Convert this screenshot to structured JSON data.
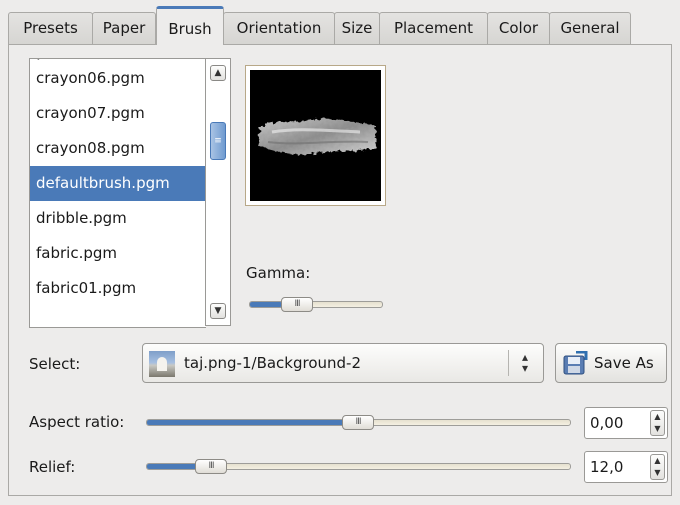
{
  "tabs": [
    {
      "label": "Presets",
      "active": false
    },
    {
      "label": "Paper",
      "active": false
    },
    {
      "label": "Brush",
      "active": true
    },
    {
      "label": "Orientation",
      "active": false
    },
    {
      "label": "Size",
      "active": false
    },
    {
      "label": "Placement",
      "active": false
    },
    {
      "label": "Color",
      "active": false
    },
    {
      "label": "General",
      "active": false
    }
  ],
  "brush_list": {
    "items": [
      "crayon06.pgm",
      "crayon07.pgm",
      "crayon08.pgm",
      "defaultbrush.pgm",
      "dribble.pgm",
      "fabric.pgm",
      "fabric01.pgm"
    ],
    "selected": "defaultbrush.pgm"
  },
  "gamma": {
    "label": "Gamma:",
    "value_fraction": 0.25
  },
  "select": {
    "label": "Select:",
    "value": "taj.png-1/Background-2"
  },
  "save_as": {
    "label": "Save As"
  },
  "aspect_ratio": {
    "label": "Aspect ratio:",
    "value": "0,00",
    "value_fraction": 0.5
  },
  "relief": {
    "label": "Relief:",
    "value": "12,0",
    "value_fraction": 0.17
  },
  "colors": {
    "accent": "#4a7ab8",
    "preview_bg": "#000000"
  }
}
